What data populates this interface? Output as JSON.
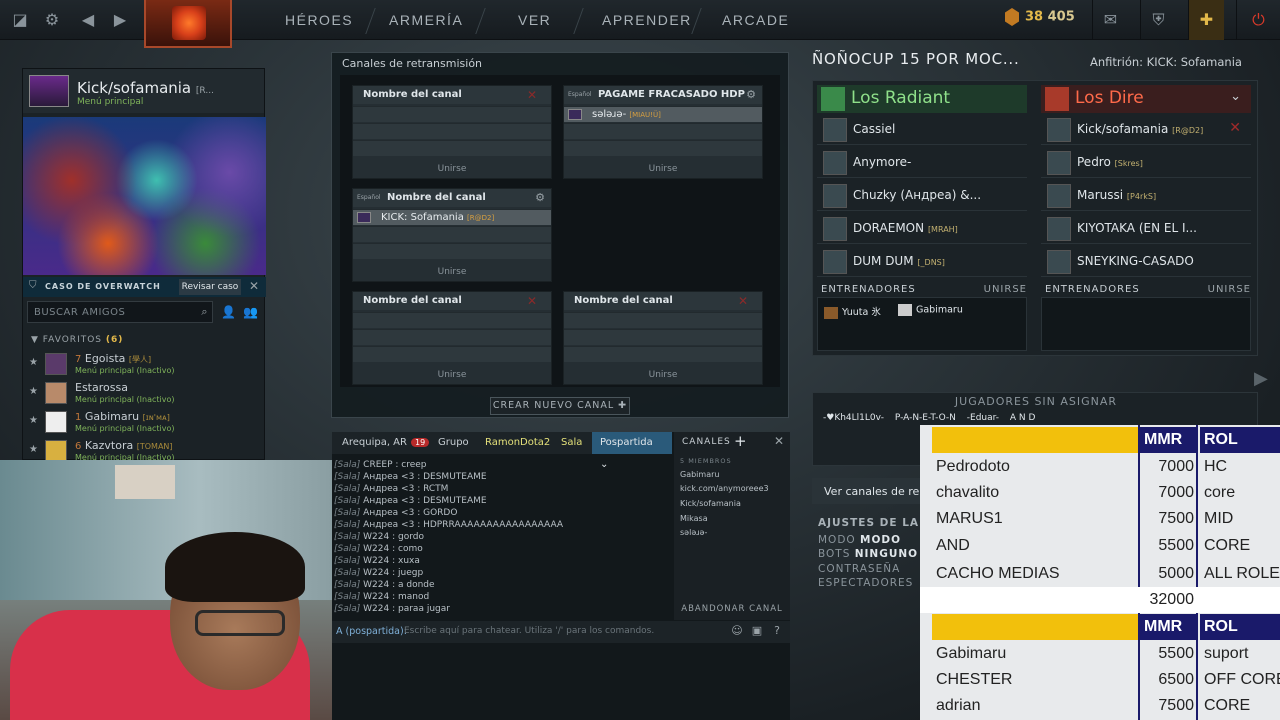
{
  "topbar": {
    "nav": [
      "HÉROES",
      "ARMERÍA",
      "VER",
      "APRENDER",
      "ARCADE"
    ],
    "shards_a": "38",
    "shards_b": "405"
  },
  "profile": {
    "name": "Kick/sofamania",
    "tag": "[R...",
    "status": "Menú principal",
    "overwatch_label": "CASO DE OVERWATCH",
    "overwatch_button": "Revisar caso",
    "search_placeholder": "BUSCAR AMIGOS",
    "favorites_label": "FAVORITOS",
    "favorites_count": "(6)",
    "friends": [
      {
        "num": "7",
        "name": "Egoista",
        "tag": "[學人]",
        "status": "Menú principal (Inactivo)"
      },
      {
        "num": "",
        "name": "Estarossa",
        "tag": "",
        "status": "Menú principal (Inactivo)"
      },
      {
        "num": "1",
        "name": "Gabimaru",
        "tag": "[ɪɴ'ᴍᴀ]",
        "status": "Menú principal (Inactivo)"
      },
      {
        "num": "6",
        "name": "Kazvtora",
        "tag": "[TOMAN]",
        "status": "Menú principal (Inactivo)"
      }
    ]
  },
  "broadcast": {
    "title": "Canales de retransmisión",
    "join_label": "Unirse",
    "create_label": "CREAR NUEVO CANAL",
    "slot_placeholder": "Nombre del canal",
    "lang": "Español",
    "channel2_name": "PAGAME FRACASADO HDP",
    "channel2_caster": "sәlәɹә-",
    "channel2_tag": "[MIAU!Ü]",
    "channel3_name": "Nombre del canal",
    "channel3_caster": "KICK: Sofamania",
    "channel3_tag": "[R@D2]"
  },
  "lobby": {
    "title": "ÑOÑOCUP 15 POR MOC...",
    "host": "Anfitrión: KICK: Sofamania",
    "radiant_label": "Los Radiant",
    "dire_label": "Los Dire",
    "radiant": [
      {
        "name": "Cassiel",
        "tag": ""
      },
      {
        "name": "Anymore-",
        "tag": ""
      },
      {
        "name": "Chuzky (Андреа) &...",
        "tag": ""
      },
      {
        "name": "DORAEMON",
        "tag": "[MRAH]"
      },
      {
        "name": "DUM DUM",
        "tag": "[_DNS]"
      }
    ],
    "dire": [
      {
        "name": "Kick/sofamania",
        "tag": "[R@D2]"
      },
      {
        "name": "Pedro",
        "tag": "[Skres]"
      },
      {
        "name": "Marussi",
        "tag": "[P4rkS]"
      },
      {
        "name": "KIYOTAKA (EN EL I...",
        "tag": ""
      },
      {
        "name": "SNEYKING-CASADO",
        "tag": ""
      }
    ],
    "coaches_label": "ENTRENADORES",
    "join_label": "UNIRSE",
    "radiant_coaches": [
      "Yuuta 氷",
      "Gabimaru"
    ],
    "unassigned_title": "JUGADORES SIN ASIGNAR",
    "unassigned": [
      "-♥Kh4Ll1L0v-",
      "P-A-N-E-T-O-N",
      "-Eduar-",
      "A N D"
    ],
    "view_channels": "Ver canales de re",
    "settings_title": "AJUSTES DE LA S",
    "settings": [
      {
        "k": "MODO",
        "v": "MODO"
      },
      {
        "k": "BOTS",
        "v": "NINGUNO"
      },
      {
        "k": "CONTRASEÑA",
        "v": ""
      },
      {
        "k": "ESPECTADORES",
        "v": ""
      }
    ]
  },
  "chat": {
    "tabs": [
      "Arequipa, AR",
      "Grupo",
      "RamonDota2",
      "Sala",
      "Pospartida"
    ],
    "badge": "19",
    "messages": [
      {
        "src": "[Sala]",
        "user": "CREEP",
        "text": "creep"
      },
      {
        "src": "[Sala]",
        "user": "Андреа <3",
        "text": "DESMUTEAME"
      },
      {
        "src": "[Sala]",
        "user": "Андреа <3",
        "text": "RCTM"
      },
      {
        "src": "[Sala]",
        "user": "Андреа <3",
        "text": "DESMUTEAME"
      },
      {
        "src": "[Sala]",
        "user": "Андреа <3",
        "text": "GORDO"
      },
      {
        "src": "[Sala]",
        "user": "Андреа <3",
        "text": "HDPRRAAAAAAAAAAAAAAAAA"
      },
      {
        "src": "[Sala]",
        "user": "W224",
        "text": "gordo"
      },
      {
        "src": "[Sala]",
        "user": "W224",
        "text": "como"
      },
      {
        "src": "[Sala]",
        "user": "W224",
        "text": "xuxa"
      },
      {
        "src": "[Sala]",
        "user": "W224",
        "text": "juegp"
      },
      {
        "src": "[Sala]",
        "user": "W224",
        "text": "a donde"
      },
      {
        "src": "[Sala]",
        "user": "W224",
        "text": "manod"
      },
      {
        "src": "[Sala]",
        "user": "W224",
        "text": "paraa jugar"
      }
    ],
    "channels_label": "CANALES",
    "member_count": "5 MIEMBROS",
    "members": [
      "Gabimaru",
      "kick.com/anymoreee3",
      "Kick/sofamania",
      "Mikasa",
      "sәlәɹә-"
    ],
    "leave_label": "ABANDONAR CANAL",
    "input_label": "A (pospartida):",
    "input_placeholder": "Escribe aquí para chatear. Utiliza '/' para los comandos."
  },
  "sheet": {
    "headers": {
      "mmr": "MMR",
      "rol": "ROL"
    },
    "team1": [
      {
        "name": "Pedrodoto",
        "mmr": "7000",
        "rol": "HC"
      },
      {
        "name": "chavalito",
        "mmr": "7000",
        "rol": "core"
      },
      {
        "name": "MARUS1",
        "mmr": "7500",
        "rol": "MID"
      },
      {
        "name": "AND",
        "mmr": "5500",
        "rol": "CORE"
      },
      {
        "name": "CACHO MEDIAS",
        "mmr": "5000",
        "rol": "ALL ROLES"
      }
    ],
    "team1_total": "32000",
    "team2": [
      {
        "name": "Gabimaru",
        "mmr": "5500",
        "rol": "suport"
      },
      {
        "name": "CHESTER",
        "mmr": "6500",
        "rol": "OFF CORE"
      },
      {
        "name": "adrian",
        "mmr": "7500",
        "rol": "CORE"
      }
    ]
  }
}
